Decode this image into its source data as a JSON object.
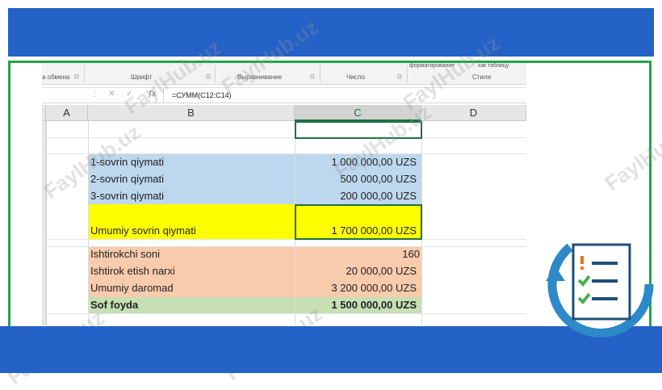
{
  "ribbon": {
    "groups": [
      {
        "label": "а обмена"
      },
      {
        "label": "Шрифт"
      },
      {
        "label": "Выравнивание"
      },
      {
        "label": "Число"
      },
      {
        "label": "Стили"
      }
    ],
    "top_labels": [
      "форматирование",
      "как таблицу"
    ]
  },
  "formula_bar": {
    "formula": "=СУММ(C12:C14)"
  },
  "columns": [
    "A",
    "B",
    "C",
    "D"
  ],
  "selected_column": "C",
  "rows": [
    {
      "label": "1-sovrin qiymati",
      "value": "1 000 000,00 UZS"
    },
    {
      "label": "2-sovrin qiymati",
      "value": "500 000,00 UZS"
    },
    {
      "label": "3-sovrin qiymati",
      "value": "200 000,00 UZS"
    },
    {
      "label": "Umumiy sovrin qiymati",
      "value": "1 700 000,00 UZS"
    },
    {
      "label": "Ishtirokchi soni",
      "value": "160"
    },
    {
      "label": "Ishtirok etish narxi",
      "value": "20 000,00 UZS"
    },
    {
      "label": "Umumiy daromad",
      "value": "3 200 000,00 UZS"
    },
    {
      "label": "Sof foyda",
      "value": "1 500 000,00 UZS"
    }
  ],
  "watermark": "FaylHub.uz",
  "colors": {
    "brand_blue": "#2462c7",
    "frame_green": "#1fa64a",
    "prize_blue": "#bdd7ee",
    "total_yellow": "#ffff00",
    "income_peach": "#f8cbad",
    "profit_green": "#c6e0b4",
    "selection_green": "#1e7145"
  }
}
